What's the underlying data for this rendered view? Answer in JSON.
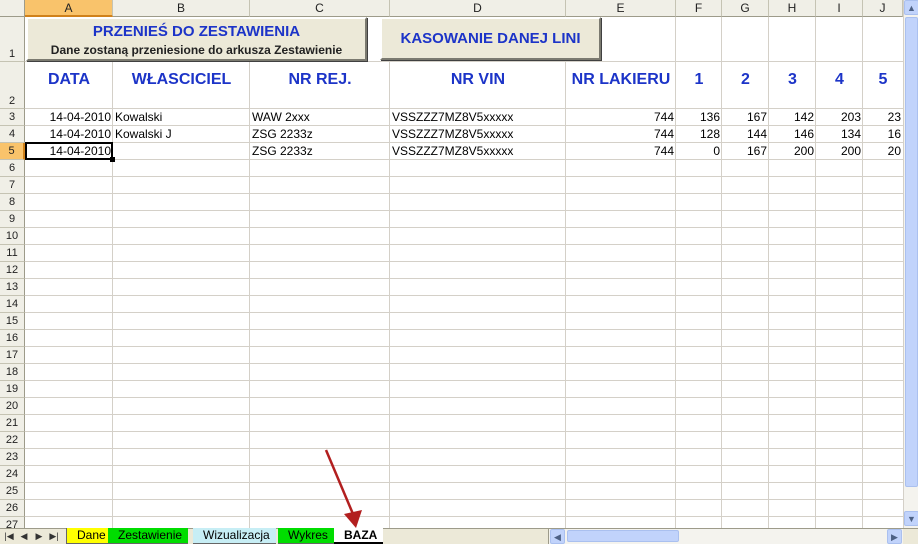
{
  "columns": [
    "A",
    "B",
    "C",
    "D",
    "E",
    "F",
    "G",
    "H",
    "I",
    "J"
  ],
  "rows": [
    "1",
    "2",
    "3",
    "4",
    "5",
    "6",
    "7",
    "8",
    "9",
    "10",
    "11",
    "12",
    "13",
    "14",
    "15",
    "16",
    "17",
    "18",
    "19",
    "20",
    "21",
    "22",
    "23",
    "24",
    "25",
    "26",
    "27"
  ],
  "buttons": {
    "transfer_title": "PRZENIEŚ DO ZESTAWIENIA",
    "transfer_subtitle": "Dane zostaną przeniesione do arkusza Zestawienie",
    "delete_line": "KASOWANIE DANEJ LINI"
  },
  "headers": {
    "data": "DATA",
    "owner": "WŁAŚCICIEL",
    "reg_no": "NR REJ.",
    "vin": "NR VIN",
    "paint_no": "NR LAKIERU",
    "m1": "1",
    "m2": "2",
    "m3": "3",
    "m4": "4",
    "m5": "5"
  },
  "table": [
    {
      "date": "14-04-2010",
      "owner": "Kowalski",
      "reg": "WAW 2xxx",
      "vin": "VSSZZZ7MZ8V5xxxxx",
      "paint": "744",
      "v1": "136",
      "v2": "167",
      "v3": "142",
      "v4": "203",
      "v5": "23"
    },
    {
      "date": "14-04-2010",
      "owner": "Kowalski J",
      "reg": "ZSG 2233z",
      "vin": "VSSZZZ7MZ8V5xxxxx",
      "paint": "744",
      "v1": "128",
      "v2": "144",
      "v3": "146",
      "v4": "134",
      "v5": "16"
    },
    {
      "date": "14-04-2010",
      "owner": "",
      "reg": "ZSG 2233z",
      "vin": "VSSZZZ7MZ8V5xxxxx",
      "paint": "744",
      "v1": "0",
      "v2": "167",
      "v3": "200",
      "v4": "200",
      "v5": "20"
    }
  ],
  "sheet_tabs": [
    {
      "label": "Dane",
      "color": "#ffff00"
    },
    {
      "label": "Zestawienie",
      "color": "#00dd00"
    },
    {
      "label": "Wizualizacja",
      "color": "#c7eef5"
    },
    {
      "label": "Wykres",
      "color": "#00dd00"
    },
    {
      "label": "BAZA",
      "color": "#ffffff"
    }
  ],
  "active_cell": "A5",
  "colors": {
    "header_text": "#1c34c8",
    "selection": "#f9c36b",
    "arrow": "#b21f1f"
  }
}
